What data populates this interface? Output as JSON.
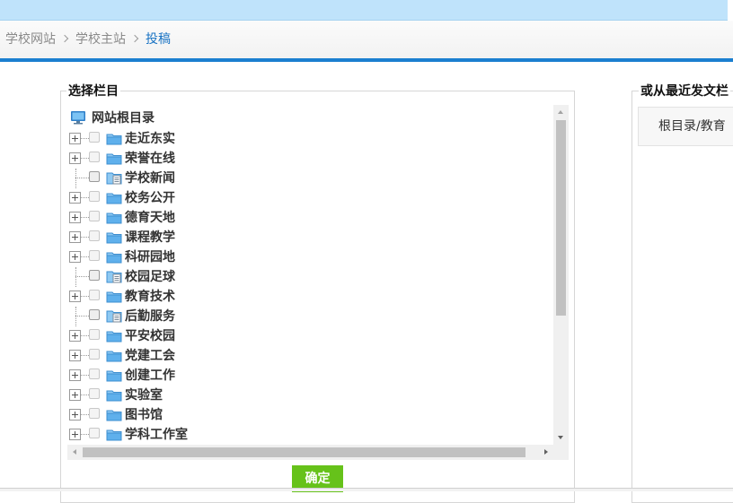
{
  "breadcrumb": {
    "items": [
      {
        "label": "学校网站"
      },
      {
        "label": "学校主站"
      },
      {
        "label": "投稿"
      }
    ]
  },
  "left_panel": {
    "title": "选择栏目",
    "root_label": "网站根目录",
    "rows": [
      {
        "label": "走近东实",
        "type": "folder",
        "expandable": true
      },
      {
        "label": "荣誉在线",
        "type": "folder",
        "expandable": true
      },
      {
        "label": "学校新闻",
        "type": "page",
        "expandable": false
      },
      {
        "label": "校务公开",
        "type": "folder",
        "expandable": true
      },
      {
        "label": "德育天地",
        "type": "folder",
        "expandable": true
      },
      {
        "label": "课程教学",
        "type": "folder",
        "expandable": true
      },
      {
        "label": "科研园地",
        "type": "folder",
        "expandable": true
      },
      {
        "label": "校园足球",
        "type": "page",
        "expandable": false
      },
      {
        "label": "教育技术",
        "type": "folder",
        "expandable": true
      },
      {
        "label": "后勤服务",
        "type": "page",
        "expandable": false
      },
      {
        "label": "平安校园",
        "type": "folder",
        "expandable": true
      },
      {
        "label": "党建工会",
        "type": "folder",
        "expandable": true
      },
      {
        "label": "创建工作",
        "type": "folder",
        "expandable": true
      },
      {
        "label": "实验室",
        "type": "folder",
        "expandable": true
      },
      {
        "label": "图书馆",
        "type": "folder",
        "expandable": true
      },
      {
        "label": "学科工作室",
        "type": "folder",
        "expandable": true
      }
    ],
    "confirm_label": "确定"
  },
  "right_panel": {
    "title": "或从最近发文栏",
    "recent_item": "根目录/教育"
  },
  "colors": {
    "accent_blue": "#1b7fd0",
    "confirm_green": "#66c21a",
    "folder_blue": "#4aa6e8",
    "top_strip": "#bfe3fb"
  },
  "icons": {
    "root": "monitor-icon",
    "folder": "folder-icon",
    "page": "page-icon"
  }
}
